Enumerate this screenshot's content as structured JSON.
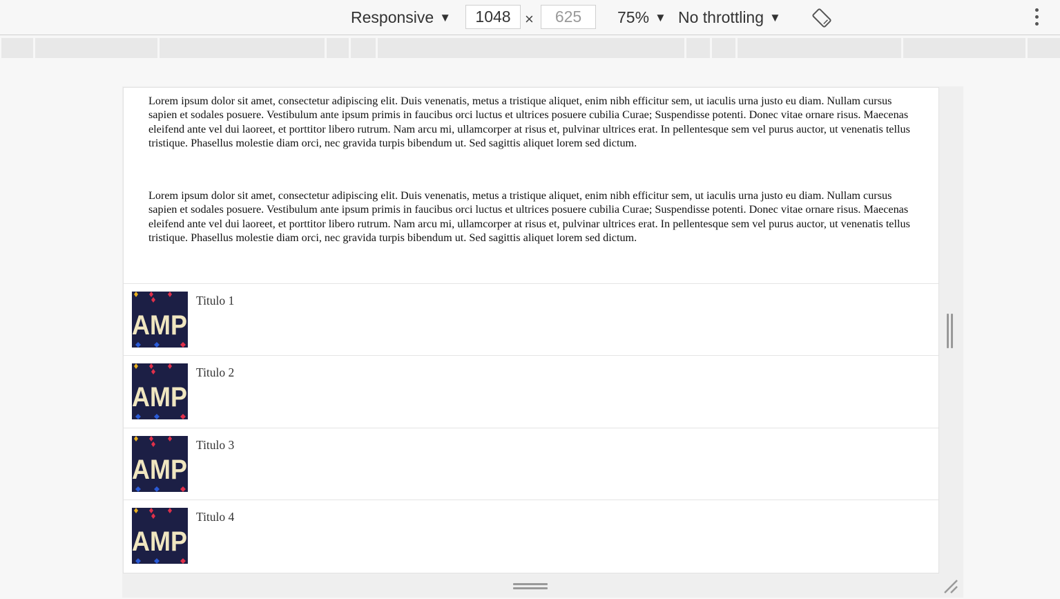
{
  "toolbar": {
    "device_label": "Responsive",
    "width_value": "1048",
    "height_placeholder": "625",
    "times": "×",
    "zoom_label": "75%",
    "throttling_label": "No throttling",
    "dropdown_arrow": "▼",
    "rotate_icon": "rotate-device-icon",
    "more_icon": "more-vertical-icon"
  },
  "content": {
    "paragraphs": [
      "Lorem ipsum dolor sit amet, consectetur adipiscing elit. Duis venenatis, metus a tristique aliquet, enim nibh efficitur sem, ut iaculis urna justo eu diam. Nullam cursus sapien et sodales posuere. Vestibulum ante ipsum primis in faucibus orci luctus et ultrices posuere cubilia Curae; Suspendisse potenti. Donec vitae ornare risus. Maecenas eleifend ante vel dui laoreet, et porttitor libero rutrum. Nam arcu mi, ullamcorper at risus et, pulvinar ultrices erat. In pellentesque sem vel purus auctor, ut venenatis tellus tristique. Phasellus molestie diam orci, nec gravida turpis bibendum ut. Sed sagittis aliquet lorem sed dictum.",
      "Lorem ipsum dolor sit amet, consectetur adipiscing elit. Duis venenatis, metus a tristique aliquet, enim nibh efficitur sem, ut iaculis urna justo eu diam. Nullam cursus sapien et sodales posuere. Vestibulum ante ipsum primis in faucibus orci luctus et ultrices posuere cubilia Curae; Suspendisse potenti. Donec vitae ornare risus. Maecenas eleifend ante vel dui laoreet, et porttitor libero rutrum. Nam arcu mi, ullamcorper at risus et, pulvinar ultrices erat. In pellentesque sem vel purus auctor, ut venenatis tellus tristique. Phasellus molestie diam orci, nec gravida turpis bibendum ut. Sed sagittis aliquet lorem sed dictum."
    ],
    "list": [
      {
        "title": "Titulo 1",
        "thumb_text": "AMP"
      },
      {
        "title": "Titulo 2",
        "thumb_text": "AMP"
      },
      {
        "title": "Titulo 3",
        "thumb_text": "AMP"
      },
      {
        "title": "Titulo 4",
        "thumb_text": "AMP"
      }
    ]
  },
  "colors": {
    "thumb_bg": "#1c1f45",
    "thumb_text": "#f0e6c0",
    "accent_red": "#e0304a",
    "accent_yellow": "#e8b020",
    "accent_blue": "#2a5bd7"
  }
}
